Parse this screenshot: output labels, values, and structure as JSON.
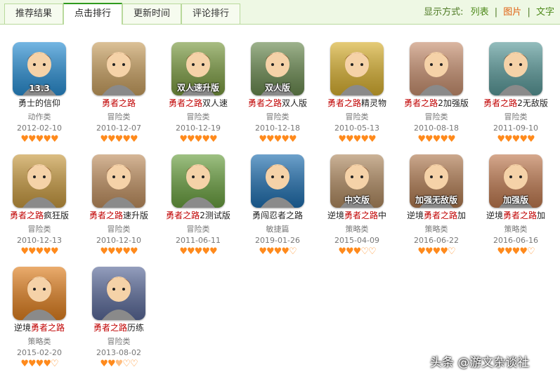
{
  "tabs": [
    {
      "label": "推荐结果",
      "active": false
    },
    {
      "label": "点击排行",
      "active": true
    },
    {
      "label": "更新时间",
      "active": false
    },
    {
      "label": "评论排行",
      "active": false
    }
  ],
  "display_mode": {
    "label": "显示方式:",
    "options": [
      {
        "label": "列表",
        "current": false
      },
      {
        "label": "图片",
        "current": true
      },
      {
        "label": "文字",
        "current": false
      }
    ]
  },
  "games": [
    {
      "pre": "勇士的信仰",
      "hl": "",
      "post": "",
      "category": "动作类",
      "date": "2012-02-10",
      "rating": 5,
      "badge": "13.3",
      "color": "#2a8fd4"
    },
    {
      "pre": "",
      "hl": "勇者之路",
      "post": "",
      "category": "冒险类",
      "date": "2010-12-07",
      "rating": 5,
      "badge": "",
      "color": "#c9a060"
    },
    {
      "pre": "",
      "hl": "勇者之路",
      "post": "双人速",
      "category": "冒险类",
      "date": "2010-12-19",
      "rating": 5,
      "badge": "双人速升版",
      "color": "#7a9a40"
    },
    {
      "pre": "",
      "hl": "勇者之路",
      "post": "双人版",
      "category": "冒险类",
      "date": "2010-12-18",
      "rating": 5,
      "badge": "双人版",
      "color": "#6a8a50"
    },
    {
      "pre": "",
      "hl": "勇者之路",
      "post": "精灵物",
      "category": "冒险类",
      "date": "2010-05-13",
      "rating": 5,
      "badge": "",
      "color": "#d8b030"
    },
    {
      "pre": "",
      "hl": "勇者之路",
      "post": "2加强版",
      "category": "冒险类",
      "date": "2010-08-18",
      "rating": 5,
      "badge": "",
      "color": "#c89070"
    },
    {
      "pre": "",
      "hl": "勇者之路",
      "post": "2无敌版",
      "category": "冒险类",
      "date": "2011-09-10",
      "rating": 5,
      "badge": "",
      "color": "#5a9a9a"
    },
    {
      "pre": "",
      "hl": "勇者之路",
      "post": "疯狂版",
      "category": "冒险类",
      "date": "2010-12-13",
      "rating": 5,
      "badge": "",
      "color": "#c89a40"
    },
    {
      "pre": "",
      "hl": "勇者之路",
      "post": "速升版",
      "category": "冒险类",
      "date": "2010-12-10",
      "rating": 5,
      "badge": "",
      "color": "#c09060"
    },
    {
      "pre": "",
      "hl": "勇者之路",
      "post": "2测试版",
      "category": "冒险类",
      "date": "2011-06-11",
      "rating": 5,
      "badge": "",
      "color": "#6aa040"
    },
    {
      "pre": "勇闯忍者之路",
      "hl": "",
      "post": "",
      "category": "敏捷篇",
      "date": "2019-01-26",
      "rating": 4,
      "badge": "",
      "color": "#1f6fb0"
    },
    {
      "pre": "逆境",
      "hl": "勇者之路",
      "post": "中",
      "category": "策略类",
      "date": "2015-04-09",
      "rating": 3,
      "badge": "中文版",
      "color": "#b08a60"
    },
    {
      "pre": "逆境",
      "hl": "勇者之路",
      "post": "加",
      "category": "策略类",
      "date": "2016-06-22",
      "rating": 4,
      "badge": "加强无敌版",
      "color": "#b07a50"
    },
    {
      "pre": "逆境",
      "hl": "勇者之路",
      "post": "加",
      "category": "策略类",
      "date": "2016-06-16",
      "rating": 4,
      "badge": "加强版",
      "color": "#c07a50"
    },
    {
      "pre": "逆境",
      "hl": "勇者之路",
      "post": "",
      "category": "策略类",
      "date": "2015-02-20",
      "rating": 4,
      "badge": "",
      "color": "#e08020"
    },
    {
      "pre": "",
      "hl": "勇者之路",
      "post": "历练",
      "category": "冒险类",
      "date": "2013-08-02",
      "rating": 2.5,
      "badge": "",
      "color": "#5a6a9a"
    }
  ],
  "watermark": "头条 @游文杂谈社"
}
